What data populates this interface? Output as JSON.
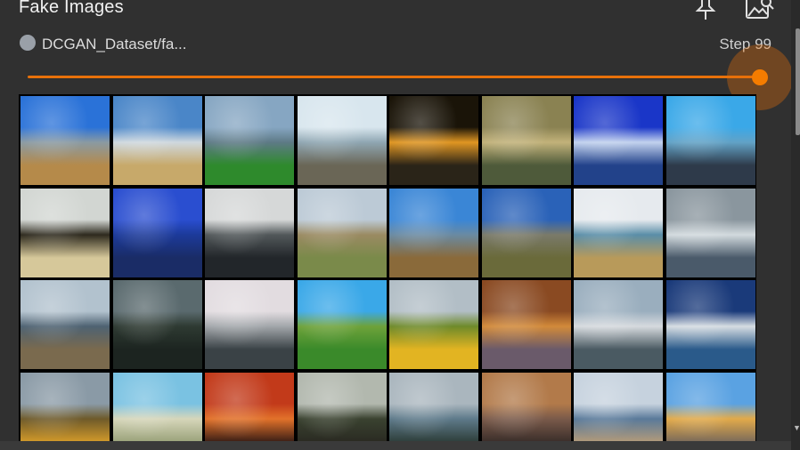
{
  "card": {
    "title": "Fake Images",
    "run_name": "DCGAN_Dataset/fa...",
    "step_label": "Step 99",
    "accent_color": "#e8710a",
    "run_dot_color": "#9aa0a8",
    "slider_level": 1.0,
    "icons": [
      "pin-icon",
      "image-icon"
    ]
  },
  "grid": {
    "rows": 4,
    "cols": 8,
    "tiles": [
      {
        "sky": "#2a72d8",
        "mid": "#8a9aa2",
        "ground": "#b58a4a"
      },
      {
        "sky": "#4a86c8",
        "mid": "#cfd8de",
        "ground": "#c7a96a"
      },
      {
        "sky": "#86a6c2",
        "mid": "#5e7a86",
        "ground": "#2e8a2c"
      },
      {
        "sky": "#d8e6ee",
        "mid": "#8fa6b2",
        "ground": "#6a6656"
      },
      {
        "sky": "#1a1408",
        "mid": "#e09622",
        "ground": "#2a2418"
      },
      {
        "sky": "#8a8252",
        "mid": "#c2b27a",
        "ground": "#4e5a3a"
      },
      {
        "sky": "#1a36c8",
        "mid": "#c2d2ee",
        "ground": "#22428a"
      },
      {
        "sky": "#3aa8e8",
        "mid": "#62a2c6",
        "ground": "#2e3a4a"
      },
      {
        "sky": "#d2d6d2",
        "mid": "#2e2a1e",
        "ground": "#d6c89a"
      },
      {
        "sky": "#2a4ed0",
        "mid": "#1c3a9a",
        "ground": "#1a2c66"
      },
      {
        "sky": "#d6d8d8",
        "mid": "#52585a",
        "ground": "#22262a"
      },
      {
        "sky": "#bccad6",
        "mid": "#9a8a62",
        "ground": "#7a8a4a"
      },
      {
        "sky": "#3a86d6",
        "mid": "#6a8aa2",
        "ground": "#8a6a3a"
      },
      {
        "sky": "#2a62b8",
        "mid": "#7a7a6a",
        "ground": "#6a6a3a"
      },
      {
        "sky": "#e6eaee",
        "mid": "#5a8ea8",
        "ground": "#b89a5a"
      },
      {
        "sky": "#8a969e",
        "mid": "#d2dade",
        "ground": "#4a5a6a"
      },
      {
        "sky": "#b2c2ce",
        "mid": "#4e6272",
        "ground": "#7a6a4e"
      },
      {
        "sky": "#5a6a6e",
        "mid": "#2e3a32",
        "ground": "#1c2420"
      },
      {
        "sky": "#e2dce0",
        "mid": "#a2a6aa",
        "ground": "#3a4246"
      },
      {
        "sky": "#3aa8e8",
        "mid": "#6ea23a",
        "ground": "#3a8a2a"
      },
      {
        "sky": "#b2bec6",
        "mid": "#6e8a2a",
        "ground": "#e2b422"
      },
      {
        "sky": "#8a4a22",
        "mid": "#d28a3a",
        "ground": "#6a5a6a"
      },
      {
        "sky": "#9aaebe",
        "mid": "#d6dade",
        "ground": "#4a5a62"
      },
      {
        "sky": "#1a3a7a",
        "mid": "#d6dde2",
        "ground": "#2a5a8a"
      },
      {
        "sky": "#8a9aa6",
        "mid": "#6e5a2a",
        "ground": "#d29a2a"
      },
      {
        "sky": "#7ac2e2",
        "mid": "#d6d6ba",
        "ground": "#9aa27a"
      },
      {
        "sky": "#c23a1a",
        "mid": "#e2722a",
        "ground": "#3a1e16"
      },
      {
        "sky": "#b2b8ae",
        "mid": "#3a4230",
        "ground": "#2a2a22"
      },
      {
        "sky": "#aab6be",
        "mid": "#5e7a8a",
        "ground": "#2e3e3a"
      },
      {
        "sky": "#b27a4a",
        "mid": "#7a5a4a",
        "ground": "#3a2e2a"
      },
      {
        "sky": "#c6d2de",
        "mid": "#5a7a9a",
        "ground": "#b29a7a"
      },
      {
        "sky": "#5aa2e2",
        "mid": "#e2aa4a",
        "ground": "#7a6a5a"
      }
    ]
  }
}
